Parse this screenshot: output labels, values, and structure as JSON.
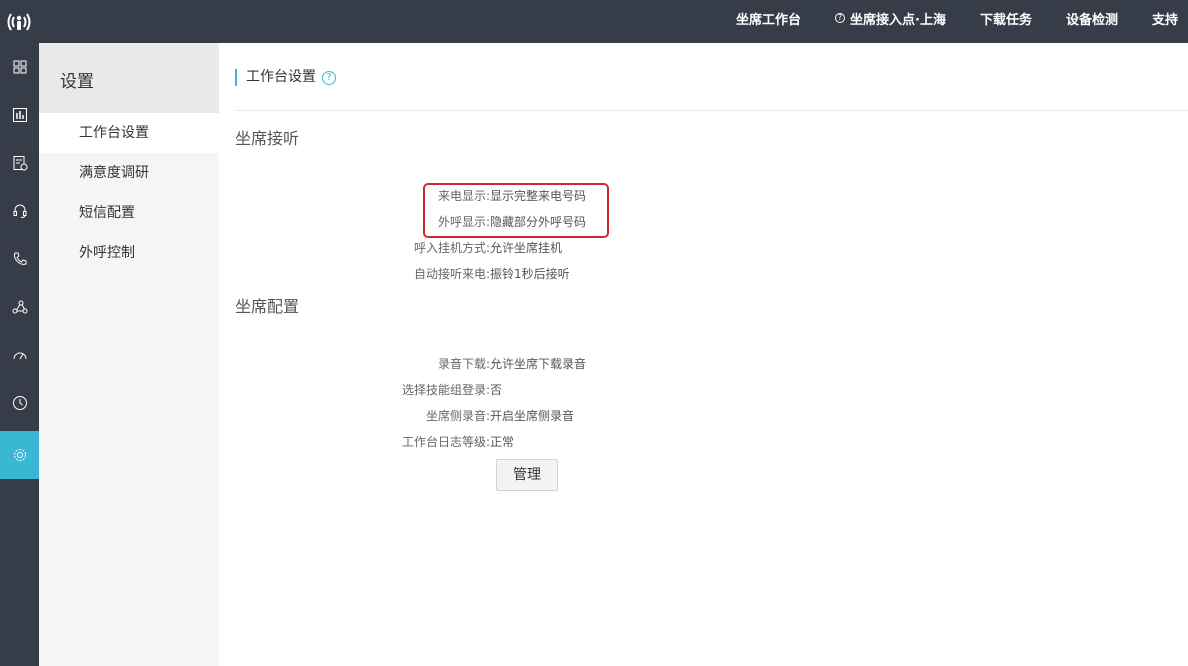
{
  "topbar": {
    "logo_icon": "broadcast-person-icon",
    "nav": [
      {
        "label": "坐席工作台"
      },
      {
        "label": "坐席接入点·上海",
        "icon": "help-icon"
      },
      {
        "label": "下载任务"
      },
      {
        "label": "设备检测"
      },
      {
        "label": "支持"
      }
    ]
  },
  "rail": {
    "icons": [
      "grid-icon",
      "bar-chart-icon",
      "report-icon",
      "headset-icon",
      "phone-icon",
      "network-icon",
      "gauge-icon",
      "clock-icon",
      "gear-icon"
    ],
    "active_index": 8
  },
  "sidebar": {
    "title": "设置",
    "items": [
      {
        "label": "工作台设置"
      },
      {
        "label": "满意度调研"
      },
      {
        "label": "短信配置"
      },
      {
        "label": "外呼控制"
      }
    ],
    "active_index": 0
  },
  "main": {
    "title": "工作台设置",
    "sections": [
      {
        "title": "坐席接听",
        "rows": [
          {
            "label": "来电显示:",
            "value": "显示完整来电号码"
          },
          {
            "label": "外呼显示:",
            "value": "隐藏部分外呼号码"
          },
          {
            "label": "呼入挂机方式:",
            "value": "允许坐席挂机"
          },
          {
            "label": "自动接听来电:",
            "value": "振铃1秒后接听"
          }
        ]
      },
      {
        "title": "坐席配置",
        "rows": [
          {
            "label": "录音下载:",
            "value": "允许坐席下载录音"
          },
          {
            "label": "选择技能组登录:",
            "value": "否"
          },
          {
            "label": "坐席侧录音:",
            "value": "开启坐席侧录音"
          },
          {
            "label": "工作台日志等级:",
            "value": "正常"
          }
        ]
      }
    ],
    "manage_button": "管理"
  },
  "colors": {
    "topbar": "#373d48",
    "accent": "#3ab7d3",
    "highlight": "#d0282a"
  }
}
